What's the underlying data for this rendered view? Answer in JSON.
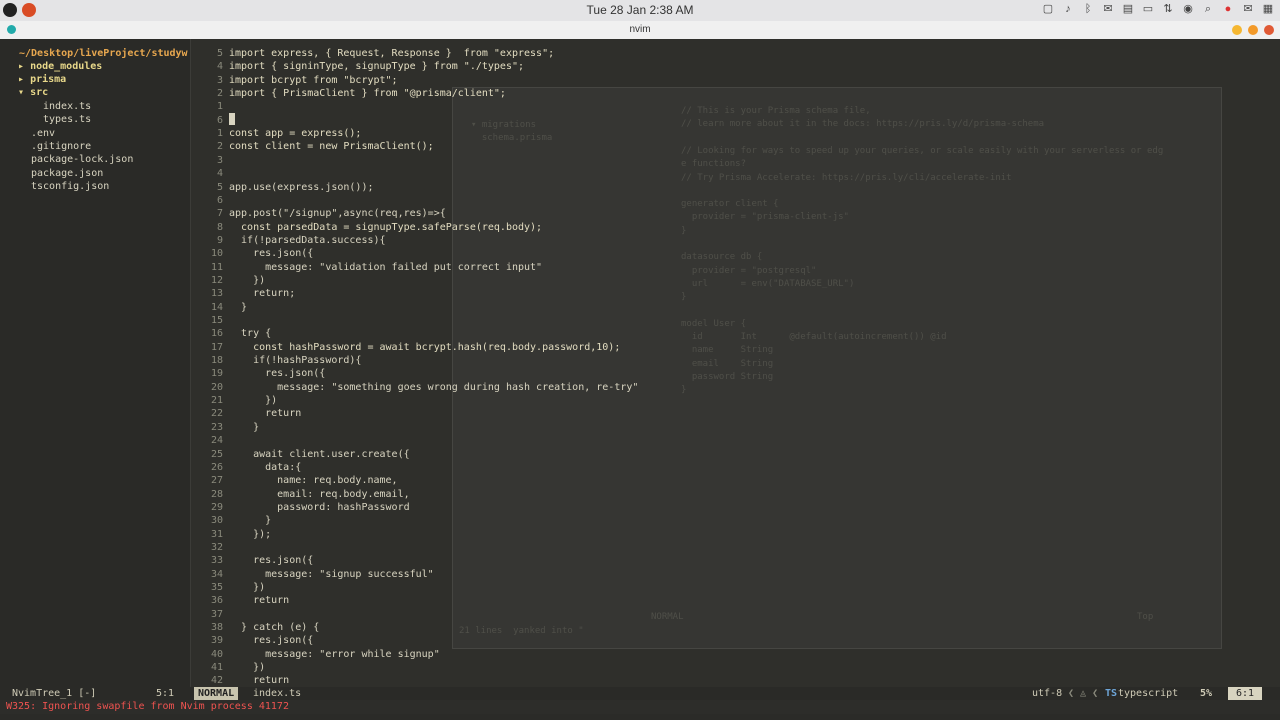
{
  "top_panel": {
    "clock": "Tue 28 Jan  2:38 AM",
    "tray_icons": [
      "window-icon",
      "volume-icon",
      "bluetooth-icon",
      "chat-icon",
      "notes-icon",
      "display-icon",
      "network-icon",
      "location-icon",
      "search-icon",
      "chrome-icon",
      "mail-icon",
      "grid-icon"
    ]
  },
  "window": {
    "title": "nvim"
  },
  "tree": {
    "root": "~/Desktop/liveProject/studyw",
    "items": [
      {
        "label": "node_modules",
        "type": "folder",
        "arrow": "▸"
      },
      {
        "label": "prisma",
        "type": "folder",
        "arrow": "▸"
      },
      {
        "label": "src",
        "type": "folder",
        "arrow": "▾"
      },
      {
        "label": "index.ts",
        "type": "file"
      },
      {
        "label": "types.ts",
        "type": "file"
      },
      {
        "label": ".env",
        "type": "file"
      },
      {
        "label": ".gitignore",
        "type": "file"
      },
      {
        "label": "package-lock.json",
        "type": "file"
      },
      {
        "label": "package.json",
        "type": "file"
      },
      {
        "label": "tsconfig.json",
        "type": "file"
      }
    ]
  },
  "gutter": [
    "5",
    "4",
    "3",
    "2",
    "1",
    "6",
    "1",
    "2",
    "3",
    "4",
    "5",
    "6",
    "7",
    "8",
    "9",
    "10",
    "11",
    "12",
    "13",
    "14",
    "15",
    "16",
    "17",
    "18",
    "19",
    "20",
    "21",
    "22",
    "23",
    "24",
    "25",
    "26",
    "27",
    "28",
    "29",
    "30",
    "31",
    "32",
    "33",
    "34",
    "35",
    "36",
    "37",
    "38",
    "39",
    "40",
    "41",
    "42"
  ],
  "code_lines": [
    "import express, { Request, Response }  from \"express\";",
    "import { signinType, signupType } from \"./types\";",
    "import bcrypt from \"bcrypt\";",
    "import { PrismaClient } from \"@prisma/client\";",
    "",
    "",
    "const app = express();",
    "const client = new PrismaClient();",
    "",
    "",
    "app.use(express.json());",
    "",
    "app.post(\"/signup\",async(req,res)=>{",
    "  const parsedData = signupType.safeParse(req.body);",
    "  if(!parsedData.success){",
    "    res.json({",
    "      message: \"validation failed put correct input\"",
    "    })",
    "    return;",
    "  }",
    "",
    "  try {",
    "    const hashPassword = await bcrypt.hash(req.body.password,10);",
    "    if(!hashPassword){",
    "      res.json({",
    "        message: \"something goes wrong during hash creation, re-try\"",
    "      })",
    "      return",
    "    }",
    "",
    "    await client.user.create({",
    "      data:{",
    "        name: req.body.name,",
    "        email: req.body.email,",
    "        password: hashPassword",
    "      }",
    "    });",
    "",
    "    res.json({",
    "      message: \"signup successful\"",
    "    })",
    "    return",
    "",
    "  } catch (e) {",
    "    res.json({",
    "      message: \"error while signup\"",
    "    })",
    "    return"
  ],
  "ghost_window": {
    "tree_lines": [
      "▾ migrations",
      "  schema.prisma"
    ],
    "lines": [
      "// This is your Prisma schema file,",
      "// learn more about it in the docs: https://pris.ly/d/prisma-schema",
      "",
      "// Looking for ways to speed up your queries, or scale easily with your serverless or edg",
      "e functions?",
      "// Try Prisma Accelerate: https://pris.ly/cli/accelerate-init",
      "",
      "generator client {",
      "  provider = \"prisma-client-js\"",
      "}",
      "",
      "datasource db {",
      "  provider = \"postgresql\"",
      "  url      = env(\"DATABASE_URL\")",
      "}",
      "",
      "model User {",
      "  id       Int      @default(autoincrement()) @id",
      "  name     String",
      "  email    String",
      "  password String",
      "}"
    ],
    "status": "21 lines  yanked into \"",
    "mode": "NORMAL",
    "pos": "Top"
  },
  "statusline": {
    "left": "NvimTree_1 [-]",
    "left_pos": "5:1",
    "mode": "NORMAL",
    "file": "index.ts",
    "encoding": "utf-8",
    "filetype": "typescript",
    "filetype_icon": "TS",
    "percent": "5%",
    "cursor": "6:1"
  },
  "cmdline": {
    "message": "W325: Ignoring swapfile from Nvim process 41172"
  }
}
